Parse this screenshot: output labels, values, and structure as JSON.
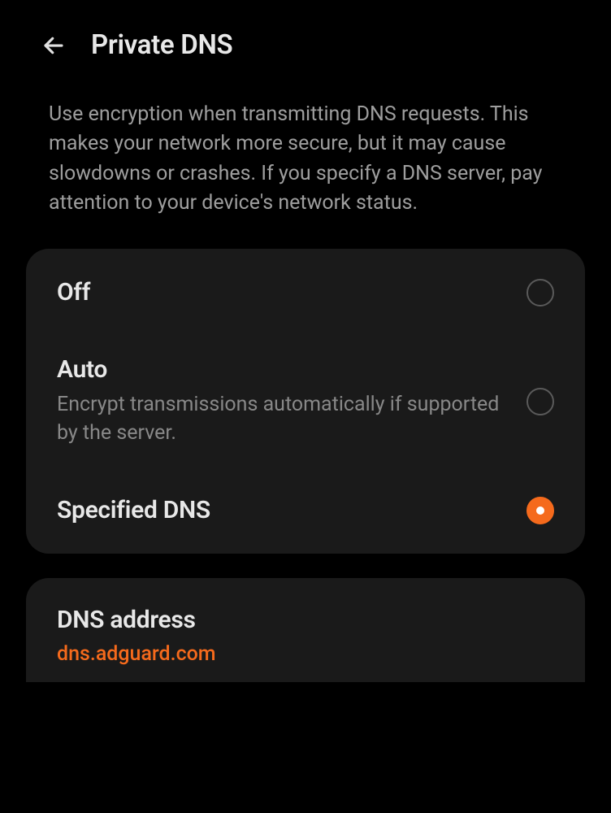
{
  "header": {
    "title": "Private DNS"
  },
  "description": "Use encryption when transmitting DNS requests. This makes your network more secure, but it may cause slowdowns or crashes. If you specify a DNS server, pay attention to your device's network status.",
  "options": {
    "off": {
      "title": "Off",
      "selected": false
    },
    "auto": {
      "title": "Auto",
      "subtitle": "Encrypt transmissions automatically if supported by the server.",
      "selected": false
    },
    "specified": {
      "title": "Specified DNS",
      "selected": true
    }
  },
  "dns_address": {
    "label": "DNS address",
    "value": "dns.adguard.com"
  },
  "colors": {
    "accent": "#f56a1c"
  }
}
